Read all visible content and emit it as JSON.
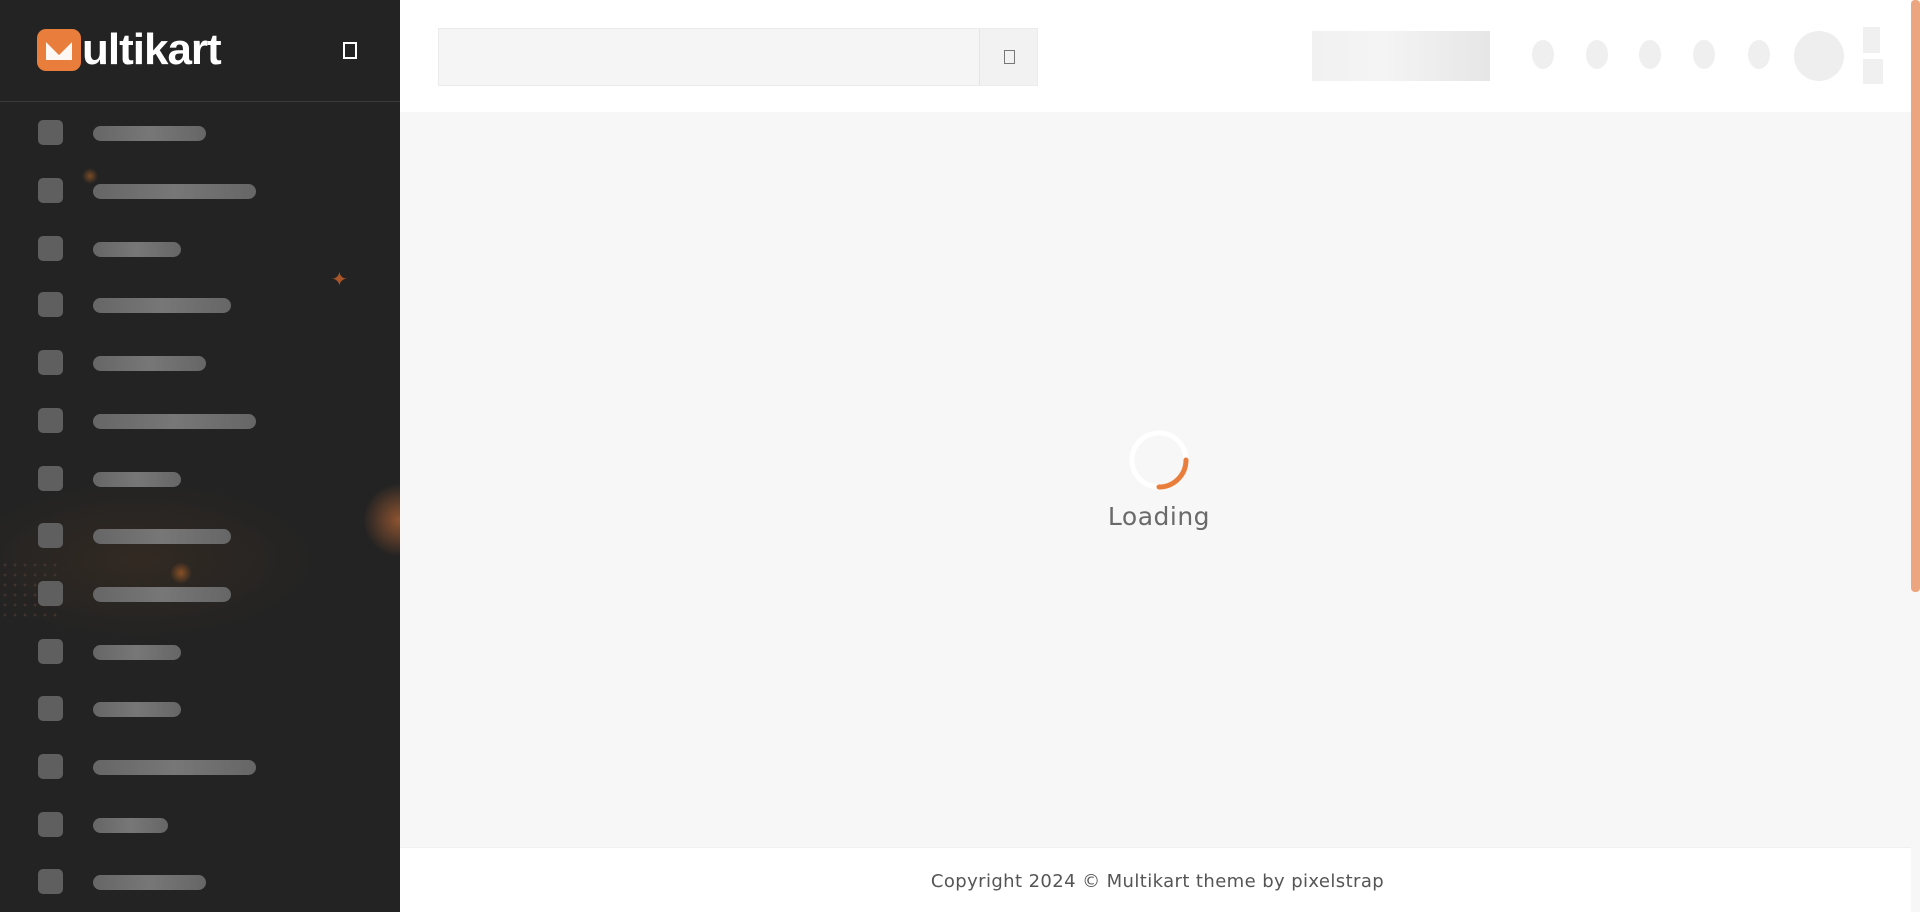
{
  "brand": {
    "logo_text": "ultikart",
    "accent_color": "#e97d3b"
  },
  "sidebar": {
    "toggle_icon": "menu-toggle-icon",
    "items": [
      {
        "top": 0,
        "w": 113
      },
      {
        "top": 0,
        "w": 163
      },
      {
        "top": 0,
        "w": 88
      },
      {
        "top": 0,
        "w": 138
      },
      {
        "top": 0,
        "w": 113
      },
      {
        "top": 0,
        "w": 163
      },
      {
        "top": 0,
        "w": 88
      },
      {
        "top": 0,
        "w": 138
      },
      {
        "top": 0,
        "w": 138
      },
      {
        "top": 0,
        "w": 88
      },
      {
        "top": 0,
        "w": 88
      },
      {
        "top": 0,
        "w": 163
      },
      {
        "top": 0,
        "w": 75
      },
      {
        "top": 0,
        "w": 113
      }
    ]
  },
  "header": {
    "search": {
      "icon": "search-icon"
    }
  },
  "main": {
    "loading_text": "Loading"
  },
  "footer": {
    "copyright": "Copyright 2024 © Multikart theme by pixelstrap"
  }
}
